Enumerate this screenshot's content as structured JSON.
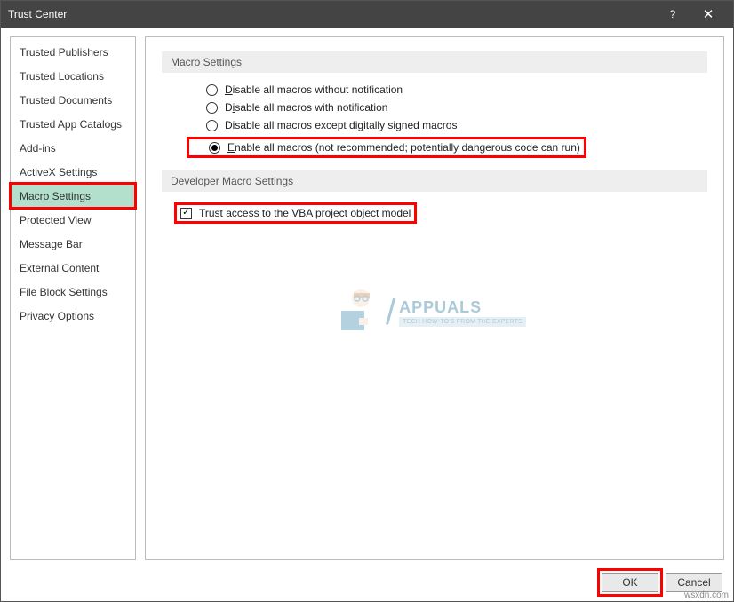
{
  "window": {
    "title": "Trust Center"
  },
  "sidebar": {
    "items": [
      {
        "label": "Trusted Publishers"
      },
      {
        "label": "Trusted Locations"
      },
      {
        "label": "Trusted Documents"
      },
      {
        "label": "Trusted App Catalogs"
      },
      {
        "label": "Add-ins"
      },
      {
        "label": "ActiveX Settings"
      },
      {
        "label": "Macro Settings"
      },
      {
        "label": "Protected View"
      },
      {
        "label": "Message Bar"
      },
      {
        "label": "External Content"
      },
      {
        "label": "File Block Settings"
      },
      {
        "label": "Privacy Options"
      }
    ],
    "selected_index": 6
  },
  "section1": {
    "header": "Macro Settings",
    "options": [
      {
        "pre": "",
        "u": "D",
        "post": "isable all macros without notification"
      },
      {
        "pre": "D",
        "u": "i",
        "post": "sable all macros with notification"
      },
      {
        "pre": "Disable all macros except di",
        "u": "g",
        "post": "itally signed macros"
      },
      {
        "pre": "",
        "u": "E",
        "post": "nable all macros (not recommended; potentially dangerous code can run)"
      }
    ],
    "selected_index": 3
  },
  "section2": {
    "header": "Developer Macro Settings",
    "checkbox": {
      "pre": "Trust access to the ",
      "u": "V",
      "post": "BA project object model",
      "checked": true
    }
  },
  "watermark": {
    "brand": "APPUALS",
    "tagline": "TECH HOW-TO'S FROM THE EXPERTS"
  },
  "footer": {
    "ok": "OK",
    "cancel": "Cancel"
  },
  "attribution": "wsxdn.com"
}
